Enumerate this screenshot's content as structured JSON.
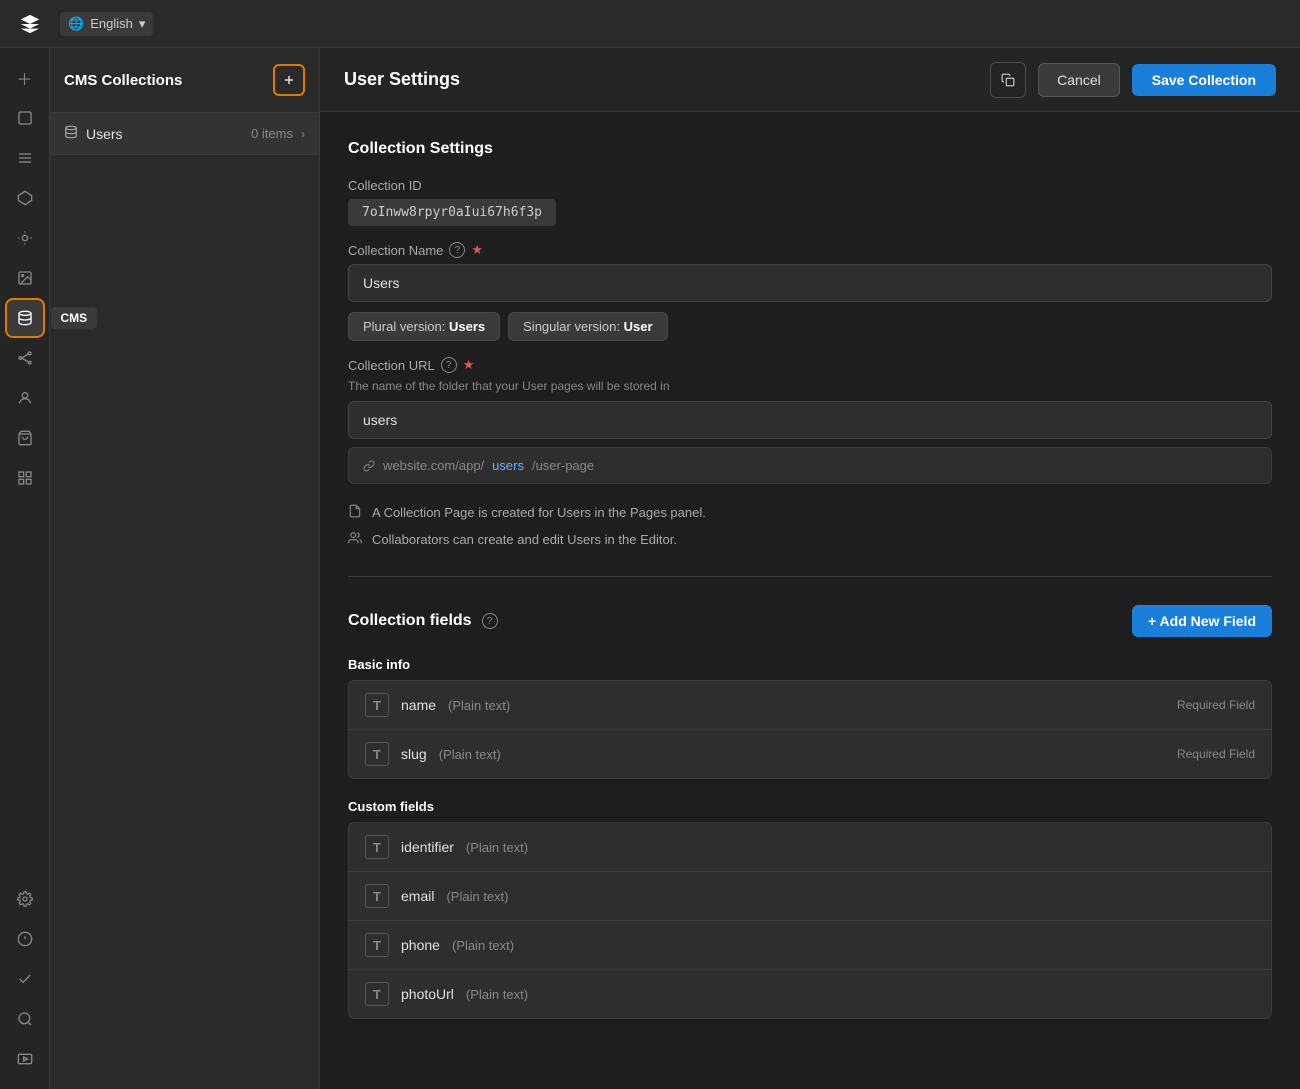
{
  "topbar": {
    "language": "English",
    "lang_icon": "🌐"
  },
  "sidebar": {
    "items": [
      {
        "id": "add",
        "icon": "+",
        "label": "Add"
      },
      {
        "id": "page",
        "icon": "⬜",
        "label": "Pages"
      },
      {
        "id": "menu",
        "icon": "≡",
        "label": "Menu"
      },
      {
        "id": "components",
        "icon": "⬡",
        "label": "Components"
      },
      {
        "id": "paint",
        "icon": "🎨",
        "label": "Design"
      },
      {
        "id": "media",
        "icon": "🖼",
        "label": "Media"
      },
      {
        "id": "cms",
        "icon": "🗄",
        "label": "CMS",
        "active": true
      },
      {
        "id": "connections",
        "icon": "⬡",
        "label": "Connections"
      },
      {
        "id": "members",
        "icon": "👤",
        "label": "Members"
      },
      {
        "id": "cart",
        "icon": "🛒",
        "label": "Store"
      },
      {
        "id": "widgets",
        "icon": "⊞",
        "label": "Widgets"
      },
      {
        "id": "settings",
        "icon": "⚙",
        "label": "Settings"
      },
      {
        "id": "integrations",
        "icon": "⊕",
        "label": "Integrations"
      },
      {
        "id": "tasks",
        "icon": "✓",
        "label": "Tasks"
      },
      {
        "id": "search",
        "icon": "🔍",
        "label": "Search"
      },
      {
        "id": "media2",
        "icon": "🎬",
        "label": "Video"
      }
    ]
  },
  "cms_panel": {
    "title": "CMS Collections",
    "add_icon": "⊞",
    "collection": {
      "icon": "≡",
      "label": "Users",
      "count": "0 items",
      "chevron": "›"
    }
  },
  "header": {
    "title": "User Settings",
    "cancel_label": "Cancel",
    "save_label": "Save Collection"
  },
  "collection_settings": {
    "section_title": "Collection Settings",
    "id_label": "Collection ID",
    "id_value": "7oInww8rpyr0aIui67h6f3p",
    "name_label": "Collection Name",
    "name_value": "Users",
    "plural_label": "Plural version:",
    "plural_value": "Users",
    "singular_label": "Singular version:",
    "singular_value": "User",
    "url_label": "Collection URL",
    "url_description": "The name of the folder that your User pages will be stored in",
    "url_value": "users",
    "url_preview_prefix": "website.com/app/",
    "url_preview_slug": "users",
    "url_preview_suffix": "/user-page",
    "info1": "A Collection Page is created for Users in the Pages panel.",
    "info2": "Collaborators can create and edit Users in the Editor."
  },
  "collection_fields": {
    "section_title": "Collection fields",
    "add_button": "+ Add New Field",
    "basic_info_title": "Basic info",
    "basic_fields": [
      {
        "type": "T",
        "name": "name",
        "type_label": "Plain text",
        "required": "Required Field"
      },
      {
        "type": "T",
        "name": "slug",
        "type_label": "Plain text",
        "required": "Required Field"
      }
    ],
    "custom_fields_title": "Custom fields",
    "custom_fields": [
      {
        "type": "T",
        "name": "identifier",
        "type_label": "Plain text"
      },
      {
        "type": "T",
        "name": "email",
        "type_label": "Plain text"
      },
      {
        "type": "T",
        "name": "phone",
        "type_label": "Plain text"
      },
      {
        "type": "T",
        "name": "photoUrl",
        "type_label": "Plain text"
      }
    ]
  },
  "cms_tooltip": "CMS"
}
